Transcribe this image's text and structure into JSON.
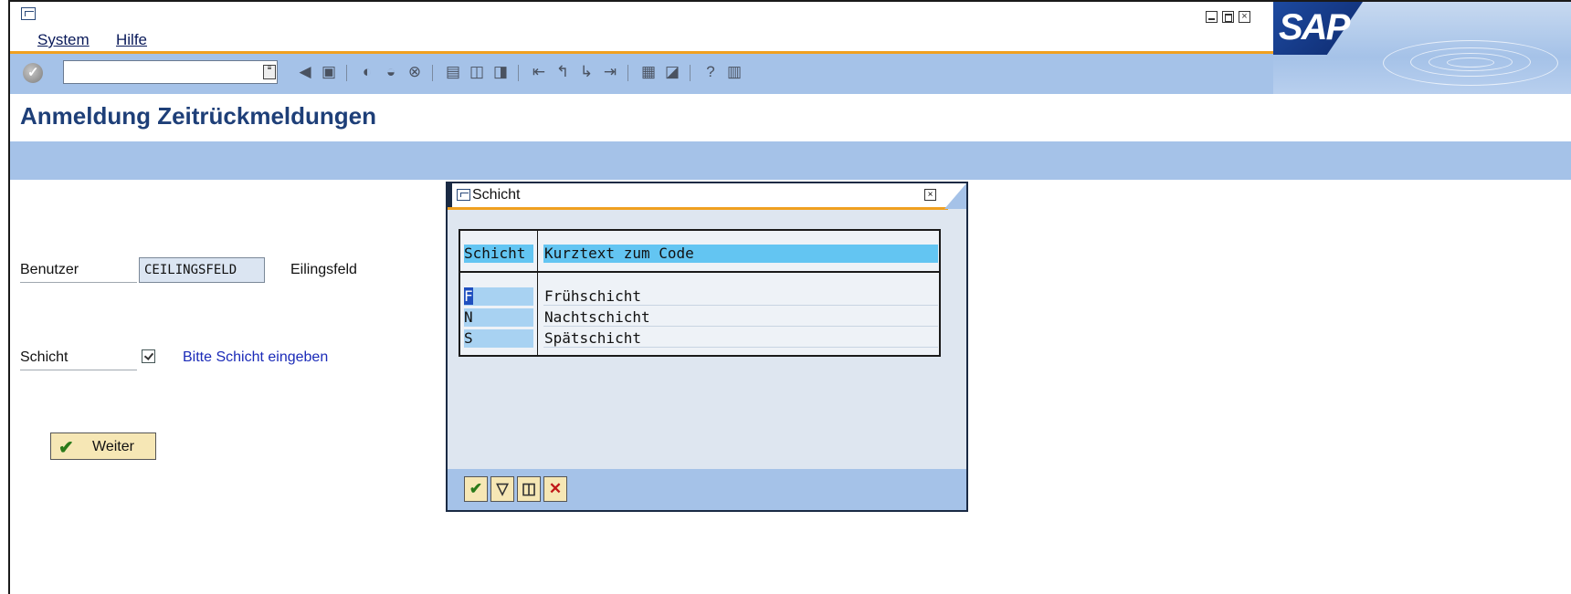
{
  "menu": {
    "items": [
      {
        "label": "System"
      },
      {
        "label": "Hilfe"
      }
    ]
  },
  "toolbar": {
    "command_field_value": "",
    "icons": [
      "enter-icon",
      "back-icon",
      "save-icon",
      "back-nav-icon",
      "exit-icon",
      "cancel-icon",
      "print-icon",
      "find-icon",
      "find-next-icon",
      "first-page-icon",
      "previous-page-icon",
      "next-page-icon",
      "last-page-icon",
      "new-session-icon",
      "shortcut-icon",
      "help-icon",
      "customize-layout-icon"
    ]
  },
  "logo": {
    "text": "SAP"
  },
  "page": {
    "title": "Anmeldung Zeitrückmeldungen"
  },
  "form": {
    "user_label": "Benutzer",
    "user_value": "CEILINGSFELD",
    "user_name": "Eilingsfeld",
    "shift_label": "Schicht",
    "shift_hint": "Bitte Schicht eingeben",
    "continue_label": "Weiter"
  },
  "dialog": {
    "title": "Schicht",
    "columns": [
      "Schicht",
      "Kurztext zum Code"
    ],
    "rows": [
      {
        "code": "F",
        "text": "Frühschicht"
      },
      {
        "code": "N",
        "text": "Nachtschicht"
      },
      {
        "code": "S",
        "text": "Spätschicht"
      }
    ],
    "buttons": [
      "confirm-icon",
      "filter-icon",
      "search-icon",
      "cancel-icon"
    ]
  },
  "colors": {
    "accent_orange": "#f0a020",
    "toolbar_blue": "#a5c2e8",
    "title_blue": "#1e3f78",
    "header_cyan": "#63c5f2",
    "button_yellow": "#f6e7b5"
  }
}
